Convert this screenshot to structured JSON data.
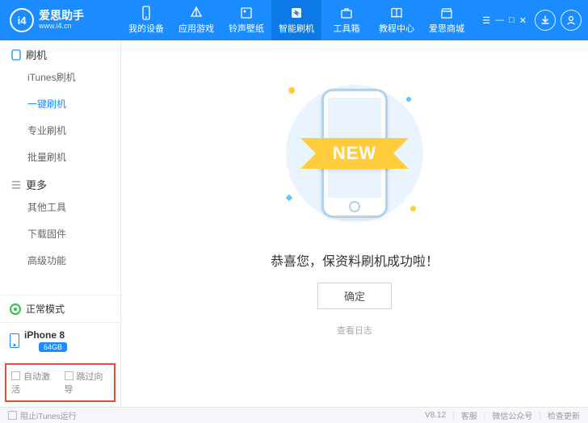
{
  "logo": {
    "mark": "i4",
    "title": "爱思助手",
    "sub": "www.i4.cn"
  },
  "nav": {
    "items": [
      {
        "label": "我的设备"
      },
      {
        "label": "应用游戏"
      },
      {
        "label": "铃声壁纸"
      },
      {
        "label": "智能刷机"
      },
      {
        "label": "工具箱"
      },
      {
        "label": "教程中心"
      },
      {
        "label": "爱思商城"
      }
    ]
  },
  "sidebar": {
    "sections": [
      {
        "title": "刷机",
        "items": [
          "iTunes刷机",
          "一键刷机",
          "专业刷机",
          "批量刷机"
        ]
      },
      {
        "title": "更多",
        "items": [
          "其他工具",
          "下载固件",
          "高级功能"
        ]
      }
    ],
    "mode": "正常模式",
    "device": {
      "name": "iPhone 8",
      "storage": "64GB"
    },
    "checks": {
      "auto_activate": "自动激活",
      "skip_guide": "跳过向导"
    }
  },
  "main": {
    "ribbon": "NEW",
    "success": "恭喜您，保资料刷机成功啦！",
    "ok": "确定",
    "log": "查看日志"
  },
  "footer": {
    "block_itunes": "阻止iTunes运行",
    "version": "V8.12",
    "support": "客服",
    "wechat": "微信公众号",
    "update": "检查更新"
  }
}
